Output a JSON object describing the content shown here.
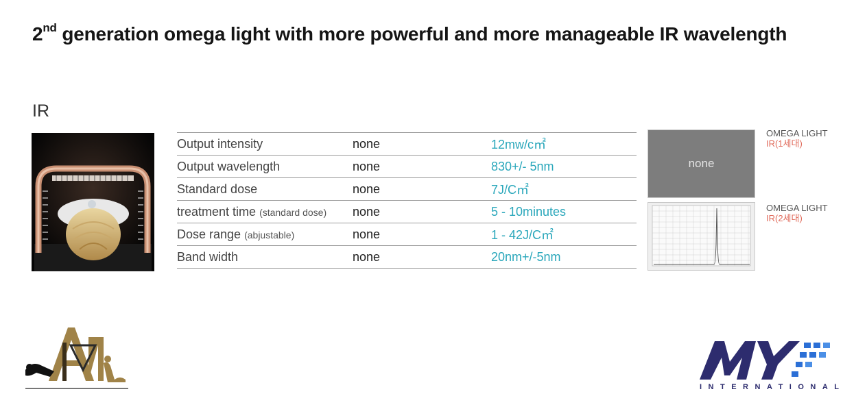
{
  "title": {
    "prefix": "2",
    "superscript": "nd",
    "text": " generation omega light with more powerful and more manageable IR wavelength"
  },
  "section_label": "IR",
  "spec_table": {
    "rows": [
      {
        "label": "Output intensity",
        "note": "",
        "value": "none",
        "spec": "12mw/c㎡"
      },
      {
        "label": "Output wavelength",
        "note": "",
        "value": "none",
        "spec": "830+/- 5nm"
      },
      {
        "label": "Standard dose",
        "note": "",
        "value": "none",
        "spec": "7J/C㎡"
      },
      {
        "label": "treatment time",
        "note": "(standard dose)",
        "value": "none",
        "spec": "5 - 10minutes"
      },
      {
        "label": "Dose range",
        "note": "(abjustable)",
        "value": "none",
        "spec": "1 - 42J/C㎡"
      },
      {
        "label": "Band width",
        "note": "",
        "value": "none",
        "spec": "20nm+/-5nm"
      }
    ]
  },
  "spectrum_panels": [
    {
      "placeholder": "none",
      "brand": "OMEGA LIGHT",
      "sub": "IR(1세대)"
    },
    {
      "placeholder": "",
      "brand": "OMEGA LIGHT",
      "sub": "IR(2세대)"
    }
  ],
  "logos": {
    "left": {
      "monogram": "AM"
    },
    "right": {
      "mark": "MY",
      "wordmark": "INTERNATIONAL"
    }
  },
  "colors": {
    "accent": "#2aa7bb",
    "label_red": "#e06a5a",
    "logo_gold": "#a08348",
    "logo_navy": "#2d2c6e",
    "logo_blue": "#2b6fd6"
  }
}
